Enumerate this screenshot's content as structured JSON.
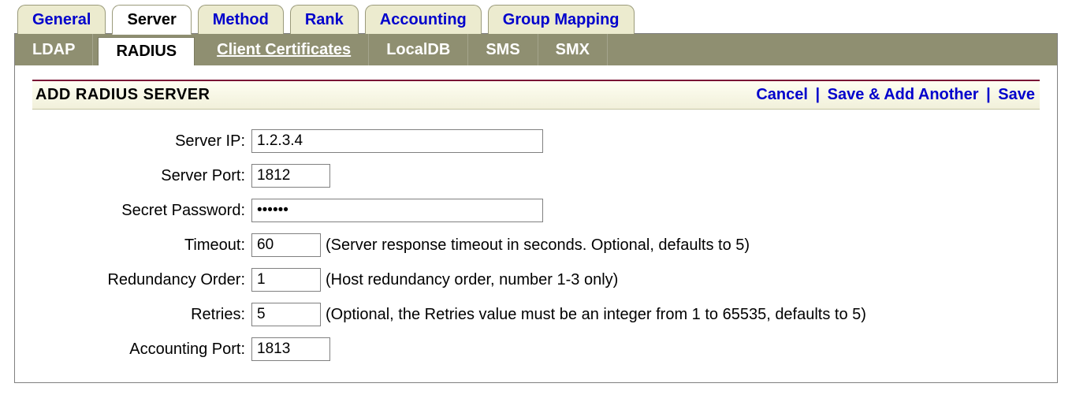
{
  "top_tabs": {
    "general": {
      "label": "General"
    },
    "server": {
      "label": "Server"
    },
    "method": {
      "label": "Method"
    },
    "rank": {
      "label": "Rank"
    },
    "accounting": {
      "label": "Accounting"
    },
    "group_map": {
      "label": "Group Mapping"
    }
  },
  "sub_tabs": {
    "ldap": {
      "label": "LDAP"
    },
    "radius": {
      "label": "RADIUS"
    },
    "client_certs": {
      "label": "Client Certificates"
    },
    "localdb": {
      "label": "LocalDB"
    },
    "sms": {
      "label": "SMS"
    },
    "smx": {
      "label": "SMX"
    }
  },
  "page": {
    "title": "ADD RADIUS SERVER"
  },
  "actions": {
    "cancel": "Cancel",
    "save_another": "Save & Add Another",
    "save": "Save"
  },
  "form": {
    "server_ip": {
      "label": "Server IP:",
      "value": "1.2.3.4"
    },
    "server_port": {
      "label": "Server Port:",
      "value": "1812"
    },
    "secret_password": {
      "label": "Secret Password:",
      "value": "••••••"
    },
    "timeout": {
      "label": "Timeout:",
      "value": "60",
      "hint": "(Server response timeout in seconds. Optional, defaults to 5)"
    },
    "redundancy_order": {
      "label": "Redundancy Order:",
      "value": "1",
      "hint": "(Host redundancy order, number 1-3 only)"
    },
    "retries": {
      "label": "Retries:",
      "value": "5",
      "hint": "(Optional, the Retries value must be an integer from 1 to 65535, defaults to 5)"
    },
    "accounting_port": {
      "label": "Accounting Port:",
      "value": "1813"
    }
  }
}
